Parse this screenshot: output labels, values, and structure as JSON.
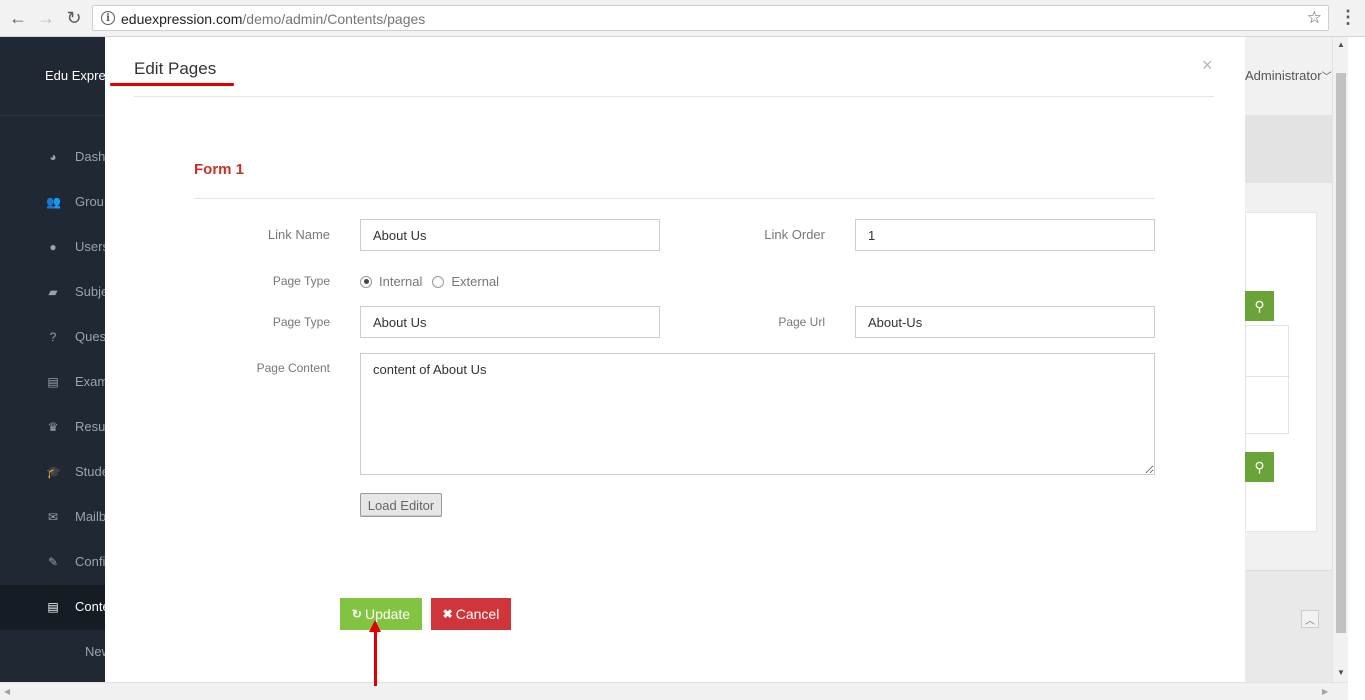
{
  "browser": {
    "url_domain": "eduexpression.com",
    "url_path": "/demo/admin/Contents/pages"
  },
  "app": {
    "brand": "Edu Expre",
    "user_menu": "Administrator"
  },
  "sidebar": {
    "items": [
      {
        "label": "Dash",
        "icon": "dashboard-icon",
        "glyph": "◕"
      },
      {
        "label": "Grou",
        "icon": "users-group-icon",
        "glyph": "👥"
      },
      {
        "label": "Users",
        "icon": "user-icon",
        "glyph": "●"
      },
      {
        "label": "Subje",
        "icon": "book-icon",
        "glyph": "▰"
      },
      {
        "label": "Ques",
        "icon": "question-icon",
        "glyph": "?"
      },
      {
        "label": "Exam",
        "icon": "list-icon",
        "glyph": "▤"
      },
      {
        "label": "Resu",
        "icon": "trophy-icon",
        "glyph": "♛"
      },
      {
        "label": "Stude",
        "icon": "graduation-cap-icon",
        "glyph": "🎓"
      },
      {
        "label": "Mailb",
        "icon": "envelope-icon",
        "glyph": "✉"
      },
      {
        "label": "Confi",
        "icon": "wrench-icon",
        "glyph": "✎"
      },
      {
        "label": "Conte",
        "icon": "list-alt-icon",
        "glyph": "▤"
      }
    ],
    "sub_item": "New"
  },
  "modal": {
    "title": "Edit Pages",
    "close": "×",
    "form_heading": "Form 1",
    "link_name_label": "Link Name",
    "link_name_value": "About Us",
    "link_order_label": "Link Order",
    "link_order_value": "1",
    "page_type_radio_label": "Page Type",
    "radio_internal": "Internal",
    "radio_external": "External",
    "page_type_label": "Page Type",
    "page_type_value": "About Us",
    "page_url_label": "Page Url",
    "page_url_value": "About-Us",
    "page_content_label": "Page Content",
    "page_content_value": "content of About Us",
    "load_editor": "Load Editor",
    "update_label": "Update",
    "cancel_label": "Cancel"
  },
  "colors": {
    "accent_red": "#e00000",
    "form_heading": "#c9302c",
    "update_green": "#82c341",
    "cancel_red": "#d0353b",
    "sidebar_bg": "#1f2833"
  }
}
